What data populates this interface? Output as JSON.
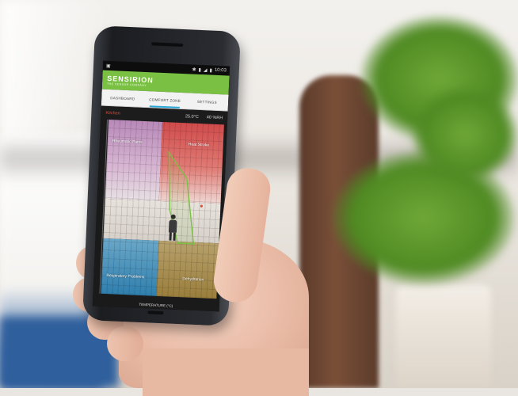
{
  "status_bar": {
    "left_icon": "notification-icon",
    "right_icons": [
      "bluetooth-icon",
      "signal-icon",
      "wifi-icon",
      "battery-icon"
    ],
    "time": "10:03"
  },
  "app": {
    "brand": "SENSIRION",
    "tagline": "THE SENSOR COMPANY",
    "brand_color": "#7ac143"
  },
  "tabs": [
    {
      "label": "DASHBOARD",
      "active": false
    },
    {
      "label": "COMFORT ZONE",
      "active": true
    },
    {
      "label": "SETTINGS",
      "active": false
    }
  ],
  "readout": {
    "location": "Kitchen",
    "temperature": "25.0°C",
    "humidity": "40 %RH"
  },
  "chart": {
    "zones": {
      "top_left": "Rheumatic Pains",
      "top_right": "Heat Stroke",
      "bottom_left": "Respiratory Problems",
      "bottom_right": "Dehydration"
    },
    "x_axis_label": "TEMPERATURE (°C)"
  }
}
